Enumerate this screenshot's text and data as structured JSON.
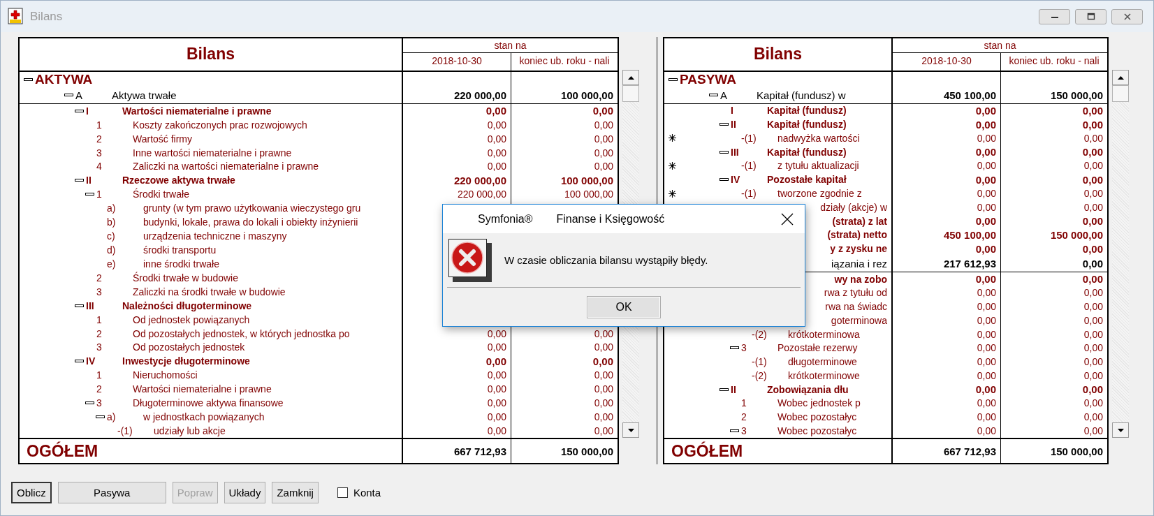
{
  "window": {
    "title": "Bilans"
  },
  "panels": [
    {
      "title": "Bilans",
      "header_group": "stan na",
      "columns": [
        "2018-10-30",
        "koniec ub. roku - nali"
      ],
      "rows": [
        {
          "kind": "root",
          "label": "AKTYWA",
          "expanded": true,
          "children": [
            {
              "kind": "section",
              "num": "A",
              "label": "Aktywa trwałe",
              "values": [
                "220 000,00",
                "100 000,00"
              ],
              "expanded": true,
              "children": [
                {
                  "kind": "group",
                  "num": "I",
                  "label": "Wartości niematerialne i prawne",
                  "values": [
                    "0,00",
                    "0,00"
                  ],
                  "expanded": true,
                  "children": [
                    {
                      "kind": "item",
                      "num": "1",
                      "label": "Koszty zakończonych prac rozwojowych",
                      "values": [
                        "0,00",
                        "0,00"
                      ],
                      "expanded": false
                    },
                    {
                      "kind": "item",
                      "num": "2",
                      "label": "Wartość firmy",
                      "values": [
                        "0,00",
                        "0,00"
                      ],
                      "expanded": false
                    },
                    {
                      "kind": "item",
                      "num": "3",
                      "label": "Inne wartości niematerialne i prawne",
                      "values": [
                        "0,00",
                        "0,00"
                      ],
                      "expanded": false
                    },
                    {
                      "kind": "item",
                      "num": "4",
                      "label": "Zaliczki na wartości niematerialne i prawne",
                      "values": [
                        "0,00",
                        "0,00"
                      ],
                      "expanded": false
                    }
                  ]
                },
                {
                  "kind": "group",
                  "num": "II",
                  "label": "Rzeczowe aktywa trwałe",
                  "values": [
                    "220 000,00",
                    "100 000,00"
                  ],
                  "expanded": true,
                  "children": [
                    {
                      "kind": "item",
                      "num": "1",
                      "label": "Środki trwałe",
                      "values": [
                        "220 000,00",
                        "100 000,00"
                      ],
                      "expanded": true,
                      "children": [
                        {
                          "kind": "item",
                          "num": "a)",
                          "label": "grunty (w tym prawo użytkowania wieczystego gru",
                          "expanded": false
                        },
                        {
                          "kind": "item",
                          "num": "b)",
                          "label": "budynki, lokale, prawa do lokali i obiekty inżynierii",
                          "expanded": false
                        },
                        {
                          "kind": "item",
                          "num": "c)",
                          "label": "urządzenia techniczne i maszyny",
                          "expanded": false
                        },
                        {
                          "kind": "item",
                          "num": "d)",
                          "label": "środki transportu",
                          "expanded": false
                        },
                        {
                          "kind": "item",
                          "num": "e)",
                          "label": "inne środki trwałe",
                          "expanded": false
                        }
                      ]
                    },
                    {
                      "kind": "item",
                      "num": "2",
                      "label": "Środki trwałe w budowie",
                      "expanded": false
                    },
                    {
                      "kind": "item",
                      "num": "3",
                      "label": "Zaliczki na środki trwałe w budowie",
                      "expanded": false
                    }
                  ]
                },
                {
                  "kind": "group",
                  "num": "III",
                  "label": "Należności długoterminowe",
                  "expanded": true,
                  "children": [
                    {
                      "kind": "item",
                      "num": "1",
                      "label": "Od jednostek powiązanych",
                      "expanded": false
                    },
                    {
                      "kind": "item",
                      "num": "2",
                      "label": "Od pozostałych jednostek, w których jednostka po",
                      "values": [
                        "0,00",
                        "0,00"
                      ],
                      "expanded": false
                    },
                    {
                      "kind": "item",
                      "num": "3",
                      "label": "Od pozostałych jednostek",
                      "values": [
                        "0,00",
                        "0,00"
                      ],
                      "expanded": false
                    }
                  ]
                },
                {
                  "kind": "group",
                  "num": "IV",
                  "label": "Inwestycje długoterminowe",
                  "values": [
                    "0,00",
                    "0,00"
                  ],
                  "expanded": true,
                  "children": [
                    {
                      "kind": "item",
                      "num": "1",
                      "label": "Nieruchomości",
                      "values": [
                        "0,00",
                        "0,00"
                      ],
                      "expanded": false
                    },
                    {
                      "kind": "item",
                      "num": "2",
                      "label": "Wartości niematerialne i prawne",
                      "values": [
                        "0,00",
                        "0,00"
                      ],
                      "expanded": false
                    },
                    {
                      "kind": "item",
                      "num": "3",
                      "label": "Długoterminowe aktywa finansowe",
                      "values": [
                        "0,00",
                        "0,00"
                      ],
                      "expanded": true,
                      "children": [
                        {
                          "kind": "item",
                          "num": "a)",
                          "label": "w jednostkach powiązanych",
                          "values": [
                            "0,00",
                            "0,00"
                          ],
                          "expanded": true,
                          "children": [
                            {
                              "kind": "item",
                              "num": "-(1)",
                              "label": "udziały lub akcje",
                              "values": [
                                "0,00",
                                "0,00"
                              ],
                              "expanded": false
                            }
                          ]
                        }
                      ]
                    }
                  ]
                }
              ]
            }
          ]
        }
      ],
      "total": {
        "label": "OGÓŁEM",
        "values": [
          "667 712,93",
          "150 000,00"
        ]
      }
    },
    {
      "title": "Bilans",
      "header_group": "stan na",
      "columns": [
        "2018-10-30",
        "koniec ub. roku - nali"
      ],
      "rows": [
        {
          "kind": "root",
          "label": "PASYWA",
          "expanded": true,
          "children": [
            {
              "kind": "section",
              "num": "A",
              "label": "Kapitał (fundusz) w",
              "values": [
                "450 100,00",
                "150 000,00"
              ],
              "expanded": true,
              "children": [
                {
                  "kind": "group",
                  "num": "I",
                  "label": "Kapitał (fundusz)",
                  "values": [
                    "0,00",
                    "0,00"
                  ],
                  "expanded": false
                },
                {
                  "kind": "group",
                  "num": "II",
                  "label": "Kapitał (fundusz)",
                  "values": [
                    "0,00",
                    "0,00"
                  ],
                  "expanded": true,
                  "children": [
                    {
                      "kind": "item",
                      "num": "-(1)",
                      "label": "nadwyżka wartości",
                      "values": [
                        "0,00",
                        "0,00"
                      ],
                      "expanded": false,
                      "flagged": true
                    }
                  ]
                },
                {
                  "kind": "group",
                  "num": "III",
                  "label": "Kapitał (fundusz)",
                  "values": [
                    "0,00",
                    "0,00"
                  ],
                  "expanded": true,
                  "children": [
                    {
                      "kind": "item",
                      "num": "-(1)",
                      "label": "z tytułu aktualizacji",
                      "values": [
                        "0,00",
                        "0,00"
                      ],
                      "expanded": false,
                      "flagged": true
                    }
                  ]
                },
                {
                  "kind": "group",
                  "num": "IV",
                  "label": "Pozostałe kapitał",
                  "values": [
                    "0,00",
                    "0,00"
                  ],
                  "expanded": true,
                  "children": [
                    {
                      "kind": "item",
                      "num": "-(1)",
                      "label": "tworzone zgodnie z",
                      "values": [
                        "0,00",
                        "0,00"
                      ],
                      "expanded": false,
                      "flagged": true
                    },
                    {
                      "kind": "item",
                      "cut": true,
                      "label": "działy (akcje) w",
                      "values": [
                        "0,00",
                        "0,00"
                      ]
                    }
                  ]
                },
                {
                  "kind": "group",
                  "cut": true,
                  "label": "(strata) z lat",
                  "values": [
                    "0,00",
                    "0,00"
                  ]
                },
                {
                  "kind": "group",
                  "cut": true,
                  "label": "(strata) netto",
                  "values": [
                    "450 100,00",
                    "150 000,00"
                  ]
                },
                {
                  "kind": "group",
                  "cut": true,
                  "label": "y z zysku ne",
                  "values": [
                    "0,00",
                    "0,00"
                  ]
                }
              ]
            },
            {
              "kind": "section",
              "cut": true,
              "label": "iązania i rez",
              "values": [
                "217 612,93",
                "0,00"
              ],
              "children": [
                {
                  "kind": "group",
                  "cut": true,
                  "label": "wy na zobo",
                  "values": [
                    "0,00",
                    "0,00"
                  ],
                  "children": [
                    {
                      "kind": "item",
                      "cut": true,
                      "label": "rwa z tytułu od",
                      "values": [
                        "0,00",
                        "0,00"
                      ]
                    },
                    {
                      "kind": "item",
                      "cut": true,
                      "label": "rwa na świadc",
                      "values": [
                        "0,00",
                        "0,00"
                      ],
                      "children": [
                        {
                          "kind": "item",
                          "cut": true,
                          "label": "goterminowa",
                          "values": [
                            "0,00",
                            "0,00"
                          ]
                        },
                        {
                          "kind": "item",
                          "num": "-(2)",
                          "label": "krótkoterminowa",
                          "values": [
                            "0,00",
                            "0,00"
                          ],
                          "expanded": false
                        }
                      ]
                    },
                    {
                      "kind": "item",
                      "num": "3",
                      "label": "Pozostałe rezerwy",
                      "values": [
                        "0,00",
                        "0,00"
                      ],
                      "expanded": true,
                      "children": [
                        {
                          "kind": "item",
                          "num": "-(1)",
                          "label": "długoterminowe",
                          "values": [
                            "0,00",
                            "0,00"
                          ],
                          "expanded": false
                        },
                        {
                          "kind": "item",
                          "num": "-(2)",
                          "label": "krótkoterminowe",
                          "values": [
                            "0,00",
                            "0,00"
                          ],
                          "expanded": false
                        }
                      ]
                    }
                  ]
                },
                {
                  "kind": "group",
                  "num": "II",
                  "label": "Zobowiązania dłu",
                  "values": [
                    "0,00",
                    "0,00"
                  ],
                  "expanded": true,
                  "children": [
                    {
                      "kind": "item",
                      "num": "1",
                      "label": "Wobec jednostek p",
                      "values": [
                        "0,00",
                        "0,00"
                      ],
                      "expanded": false
                    },
                    {
                      "kind": "item",
                      "num": "2",
                      "label": "Wobec pozostałyc",
                      "values": [
                        "0,00",
                        "0,00"
                      ],
                      "expanded": false
                    },
                    {
                      "kind": "item",
                      "num": "3",
                      "label": "Wobec pozostałyc",
                      "values": [
                        "0,00",
                        "0,00"
                      ],
                      "expanded": true
                    }
                  ]
                }
              ]
            }
          ]
        }
      ],
      "total": {
        "label": "OGÓŁEM",
        "values": [
          "667 712,93",
          "150 000,00"
        ]
      }
    }
  ],
  "buttons": [
    {
      "label": "Oblicz",
      "default": true,
      "disabled": false
    },
    {
      "label": "Pasywa",
      "default": false,
      "disabled": false
    },
    {
      "label": "Popraw",
      "default": false,
      "disabled": true
    },
    {
      "label": "Układy",
      "default": false,
      "disabled": false
    },
    {
      "label": "Zamknij",
      "default": false,
      "disabled": false
    }
  ],
  "checkbox": {
    "label": "Konta",
    "checked": false
  },
  "dialog": {
    "title": "Symfonia®",
    "subtitle": "Finanse i Księgowość",
    "message": "W czasie obliczania bilansu wystąpiły błędy.",
    "button": "OK"
  }
}
